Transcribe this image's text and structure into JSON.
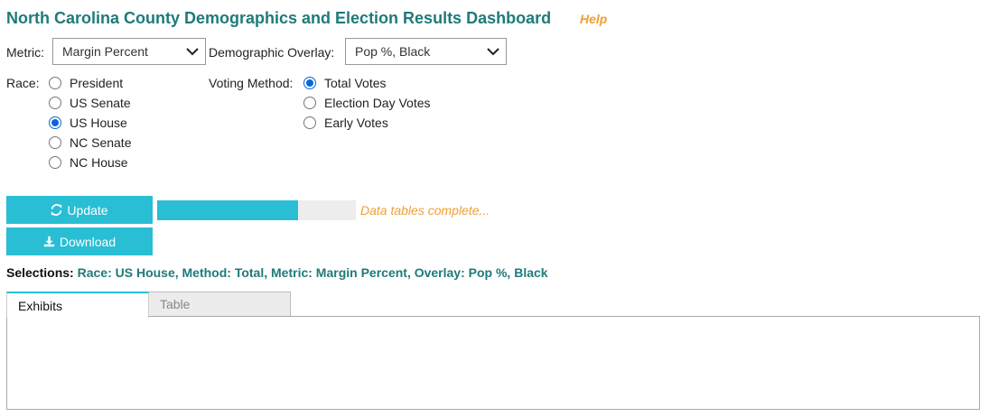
{
  "header": {
    "title": "North Carolina County Demographics and Election Results Dashboard",
    "help": "Help"
  },
  "controls": {
    "metric_label": "Metric:",
    "metric_value": "Margin Percent",
    "overlay_label": "Demographic Overlay:",
    "overlay_value": "Pop %, Black",
    "race_label": "Race:",
    "race_options": [
      "President",
      "US Senate",
      "US House",
      "NC Senate",
      "NC House"
    ],
    "race_selected": "US House",
    "method_label": "Voting Method:",
    "method_options": [
      "Total Votes",
      "Election Day Votes",
      "Early Votes"
    ],
    "method_selected": "Total Votes"
  },
  "actions": {
    "update_label": "Update",
    "download_label": "Download",
    "progress_fraction": 0.71,
    "status_text": "Data tables complete..."
  },
  "selections": {
    "prefix": "Selections:",
    "text": "Race: US House, Method: Total, Metric: Margin Percent, Overlay: Pop %, Black"
  },
  "tabs": [
    {
      "label": "Exhibits",
      "active": true
    },
    {
      "label": "Table",
      "active": false
    }
  ],
  "colors": {
    "accent": "#29bed4",
    "title": "#1f7a7a",
    "warning": "#f0a030",
    "radio": "#0a66d8"
  }
}
